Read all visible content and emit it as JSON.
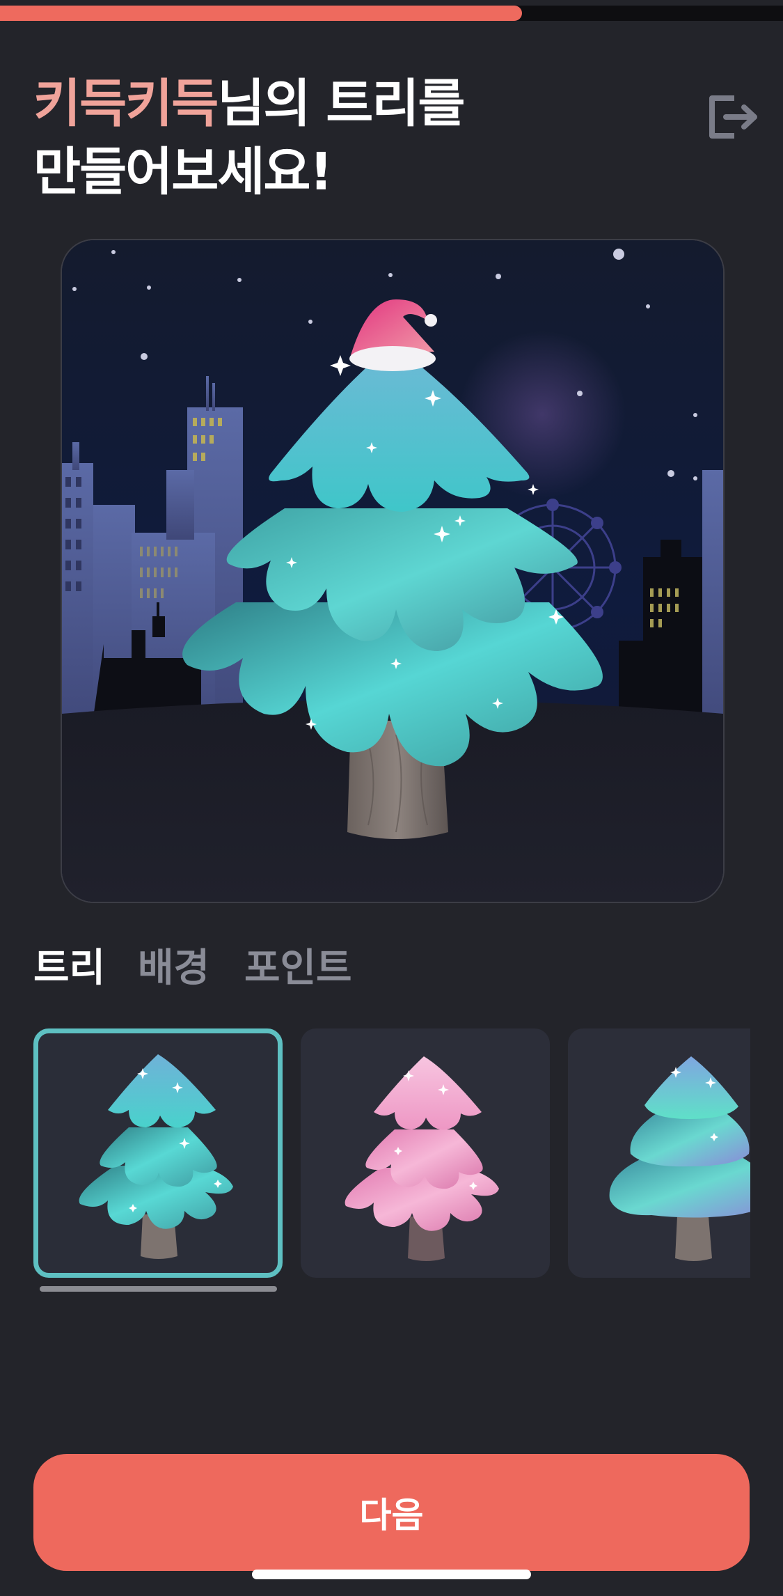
{
  "progress": {
    "fraction": 0.667
  },
  "header": {
    "title_highlight": "키득키득",
    "title_rest_line1": "님의 트리를",
    "title_line2": "만들어보세요!",
    "exit_icon": "exit-icon"
  },
  "preview": {
    "scene": "christmas-tree-city-night"
  },
  "tabs": [
    {
      "label": "트리",
      "active": true
    },
    {
      "label": "배경",
      "active": false
    },
    {
      "label": "포인트",
      "active": false
    }
  ],
  "options": [
    {
      "name": "aqua-tree",
      "selected": true
    },
    {
      "name": "pink-tree",
      "selected": false
    },
    {
      "name": "aurora-tree",
      "selected": false
    }
  ],
  "next_button": {
    "label": "다음"
  },
  "colors": {
    "accent": "#ee695d",
    "highlight_text": "#f0a39a",
    "selection_border": "#5ec0c2",
    "background": "#23242a"
  }
}
